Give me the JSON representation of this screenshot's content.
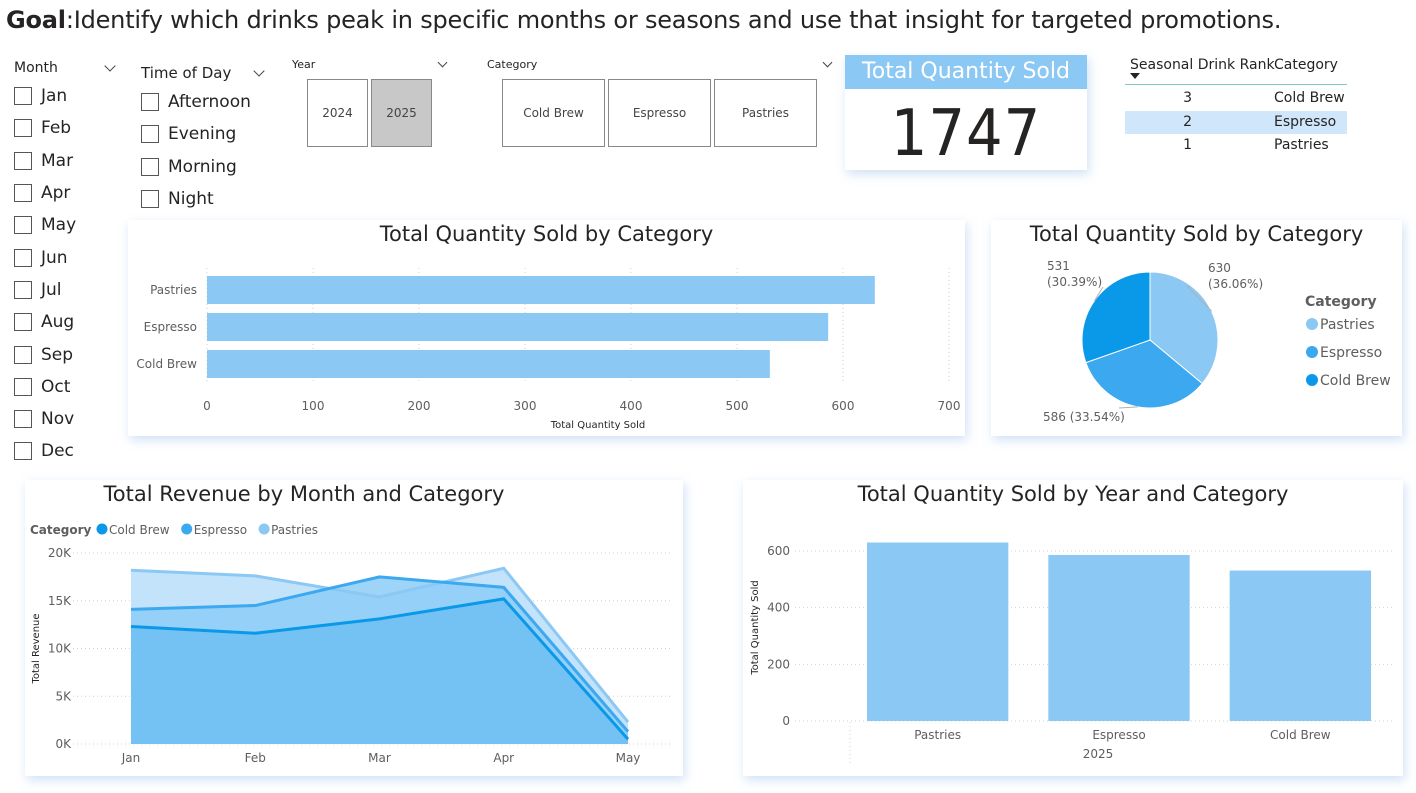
{
  "goal": {
    "bold": "Goal",
    "text": ":Identify which drinks peak in specific months or seasons and use that insight for targeted promotions."
  },
  "month_slicer": {
    "title": "Month",
    "items": [
      "Jan",
      "Feb",
      "Mar",
      "Apr",
      "May",
      "Jun",
      "Jul",
      "Aug",
      "Sep",
      "Oct",
      "Nov",
      "Dec"
    ]
  },
  "time_slicer": {
    "title": "Time of Day",
    "items": [
      "Afternoon",
      "Evening",
      "Morning",
      "Night"
    ]
  },
  "year_slicer": {
    "title": "Year",
    "items": [
      "2024",
      "2025"
    ],
    "selected": "2025"
  },
  "category_slicer": {
    "title": "Category",
    "items": [
      "Cold Brew",
      "Espresso",
      "Pastries"
    ]
  },
  "kpi": {
    "title": "Total Quantity Sold",
    "value": "1747"
  },
  "rank_table": {
    "headers": [
      "Seasonal Drink Rank",
      "Category"
    ],
    "rows": [
      {
        "rank": "3",
        "category": "Cold Brew"
      },
      {
        "rank": "2",
        "category": "Espresso",
        "highlighted": true
      },
      {
        "rank": "1",
        "category": "Pastries"
      }
    ]
  },
  "colors": {
    "light": "#8cc8f4",
    "medium": "#3ba8f0",
    "dark": "#0a98e8",
    "kpi_header": "#8cc8f4"
  },
  "chart_data": [
    {
      "type": "bar",
      "orientation": "horizontal",
      "title": "Total Quantity Sold by Category",
      "categories": [
        "Pastries",
        "Espresso",
        "Cold Brew"
      ],
      "values": [
        630,
        586,
        531
      ],
      "xlabel": "Total Quantity Sold",
      "xlim": [
        0,
        700
      ],
      "xticks": [
        "0",
        "100",
        "200",
        "300",
        "400",
        "500",
        "600",
        "700"
      ]
    },
    {
      "type": "pie",
      "title": "Total Quantity Sold by Category",
      "legend_title": "Category",
      "legend_position": "right",
      "slices": [
        {
          "label": "Pastries",
          "value": 630,
          "data_label": "630\n(36.06%)",
          "color": "#8cc8f4"
        },
        {
          "label": "Espresso",
          "value": 586,
          "data_label": "586 (33.54%)",
          "color": "#3ba8f0"
        },
        {
          "label": "Cold Brew",
          "value": 531,
          "data_label": "531\n(30.39%)",
          "color": "#0a98e8"
        }
      ]
    },
    {
      "type": "area",
      "title": "Total Revenue by Month and Category",
      "legend_title": "Category",
      "legend_position": "top-left",
      "categories": [
        "Jan",
        "Feb",
        "Mar",
        "Apr",
        "May"
      ],
      "ylabel": "Total Revenue",
      "ylim": [
        0,
        20000
      ],
      "yticks": [
        "0K",
        "5K",
        "10K",
        "15K",
        "20K"
      ],
      "series": [
        {
          "name": "Cold Brew",
          "values": [
            12300,
            11600,
            13100,
            15200,
            500
          ],
          "color": "#0a98e8"
        },
        {
          "name": "Espresso",
          "values": [
            14100,
            14500,
            17500,
            16400,
            1300
          ],
          "color": "#3ba8f0"
        },
        {
          "name": "Pastries",
          "values": [
            18200,
            17600,
            15400,
            18400,
            2300
          ],
          "color": "#8cc8f4"
        }
      ]
    },
    {
      "type": "bar",
      "orientation": "vertical",
      "title": "Total Quantity Sold by Year and Category",
      "categories": [
        "Pastries",
        "Espresso",
        "Cold Brew"
      ],
      "group_label": "2025",
      "values": [
        630,
        586,
        531
      ],
      "ylabel": "Total Quantity Sold",
      "ylim": [
        0,
        660
      ],
      "yticks": [
        "0",
        "200",
        "400",
        "600"
      ]
    }
  ]
}
